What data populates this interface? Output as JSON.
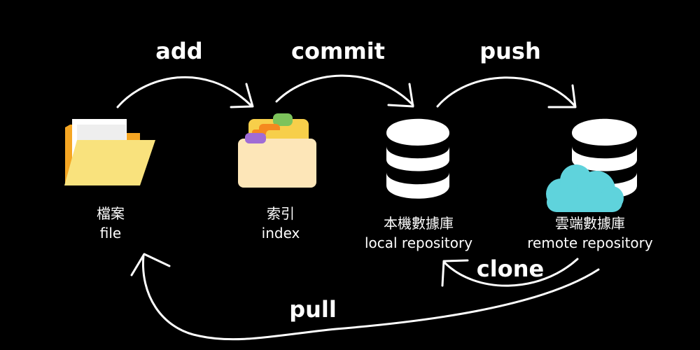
{
  "nodes": {
    "file": {
      "zh": "檔案",
      "en": "file"
    },
    "index": {
      "zh": "索引",
      "en": "index"
    },
    "local": {
      "zh": "本機數據庫",
      "en": "local repository"
    },
    "remote": {
      "zh": "雲端數據庫",
      "en": "remote repository"
    }
  },
  "actions": {
    "add": "add",
    "commit": "commit",
    "push": "push",
    "clone": "clone",
    "pull": "pull"
  },
  "colors": {
    "background": "#000000",
    "folder_back": "#F5A623",
    "folder_front": "#F9E27D",
    "index_box": "#FDE6B8",
    "tab_green": "#7CC35B",
    "tab_orange": "#F5891F",
    "tab_purple": "#A06CD5",
    "tab_yellow": "#F7CF4A",
    "database": "#FFFFFF",
    "cloud": "#5FD3DC"
  }
}
